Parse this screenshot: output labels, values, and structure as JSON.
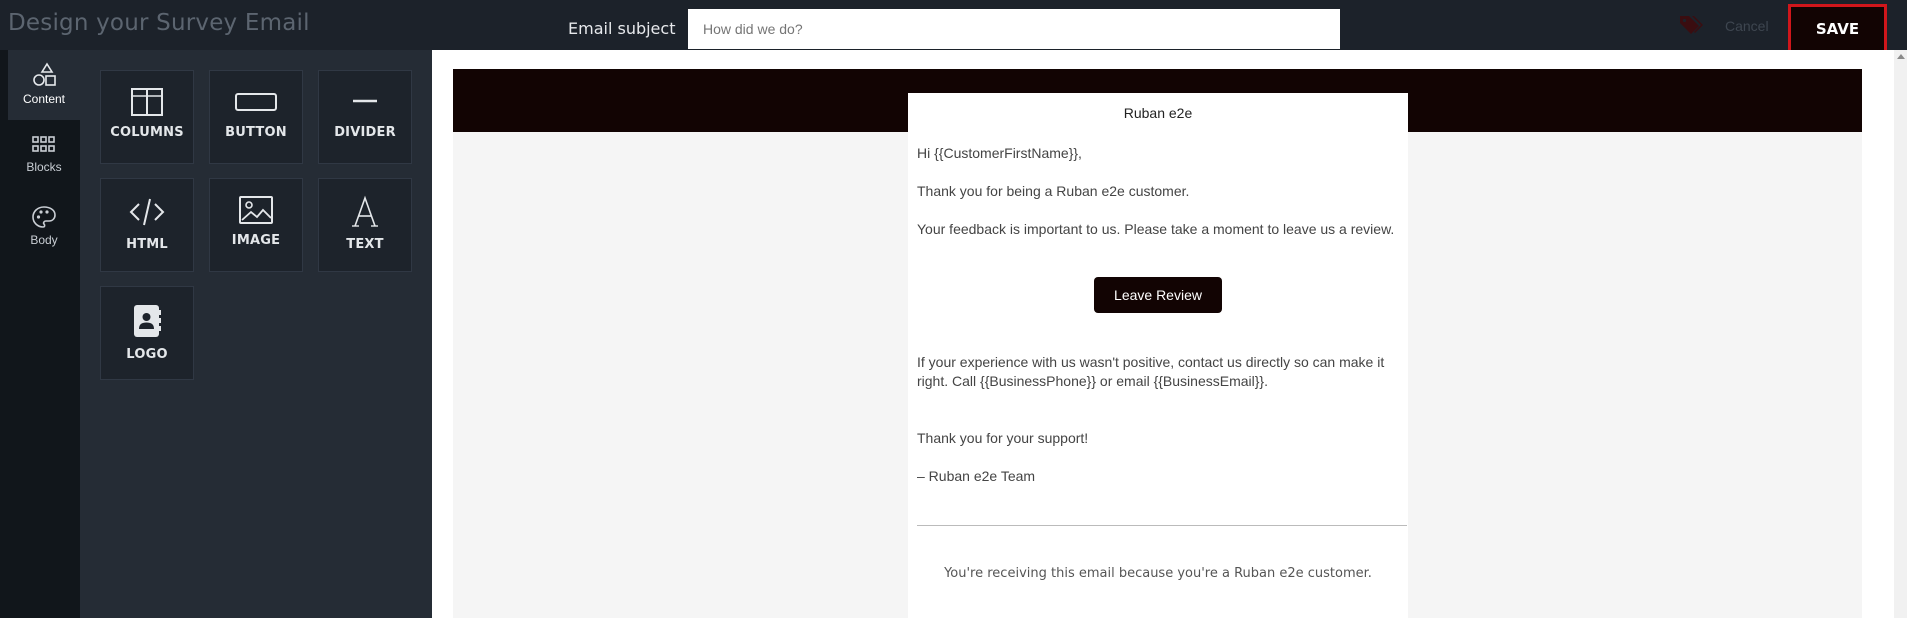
{
  "header": {
    "title": "Design your Survey Email",
    "subject_label": "Email subject",
    "subject_placeholder": "How did we do?",
    "cancel_label": "Cancel",
    "save_label": "SAVE"
  },
  "rail": {
    "items": [
      {
        "label": "Content",
        "icon": "shapes-icon"
      },
      {
        "label": "Blocks",
        "icon": "grid-icon"
      },
      {
        "label": "Body",
        "icon": "palette-icon"
      }
    ]
  },
  "tools": [
    {
      "label": "COLUMNS",
      "icon": "columns-icon"
    },
    {
      "label": "BUTTON",
      "icon": "button-icon"
    },
    {
      "label": "DIVIDER",
      "icon": "divider-icon"
    },
    {
      "label": "HTML",
      "icon": "code-icon"
    },
    {
      "label": "IMAGE",
      "icon": "image-icon"
    },
    {
      "label": "TEXT",
      "icon": "text-icon"
    },
    {
      "label": "LOGO",
      "icon": "contact-book-icon"
    }
  ],
  "email": {
    "title": "Ruban e2e",
    "greeting": "Hi {{CustomerFirstName}},",
    "line1": "Thank you for being a Ruban e2e customer.",
    "line2": "Your feedback is important to us. Please take a moment to leave us a review.",
    "button_label": "Leave Review",
    "line3": "If your experience with us wasn't positive, contact us directly so can make it right. Call {{BusinessPhone}} or email {{BusinessEmail}}.",
    "line4": "Thank you for your support!",
    "signature": "– Ruban e2e Team",
    "footer": "You're receiving this email because you're a Ruban e2e customer."
  },
  "colors": {
    "brand_dark": "#120403",
    "highlight_border": "#d0161b",
    "editor_dark": "#1c222a",
    "panel": "#252c35"
  }
}
